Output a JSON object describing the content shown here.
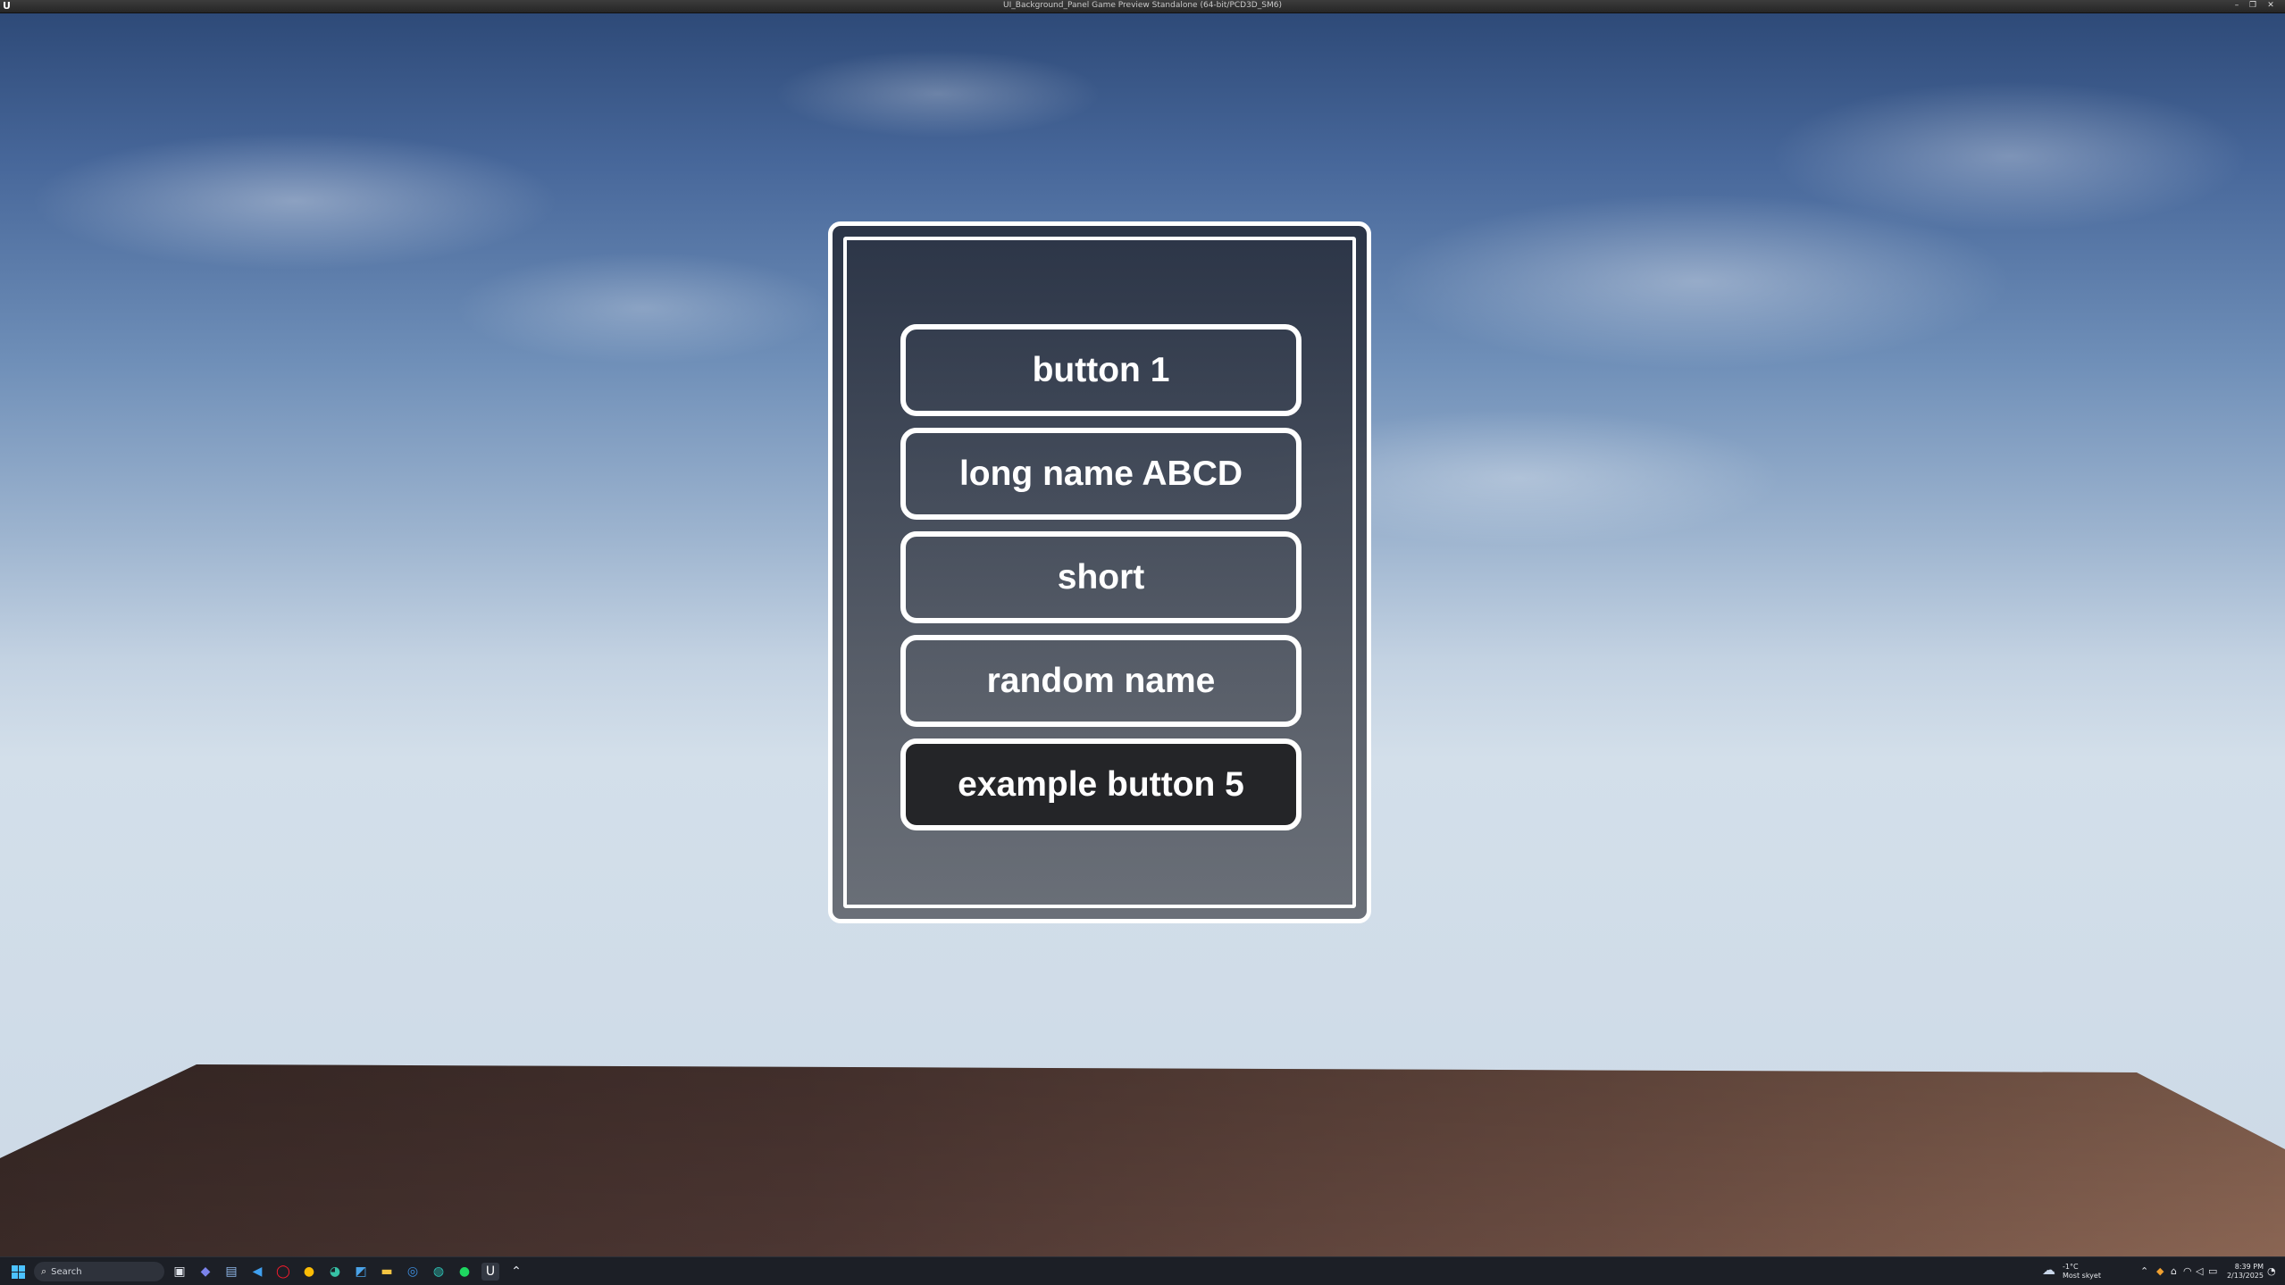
{
  "window": {
    "title": "UI_Background_Panel Game Preview Standalone (64-bit/PCD3D_SM6)",
    "minimize": "–",
    "restore": "❐",
    "close": "✕"
  },
  "menu": {
    "buttons": [
      {
        "label": "button 1",
        "hovered": false
      },
      {
        "label": "long name ABCD",
        "hovered": false
      },
      {
        "label": "short",
        "hovered": false
      },
      {
        "label": "random name",
        "hovered": false
      },
      {
        "label": "example button 5",
        "hovered": true
      }
    ]
  },
  "taskbar": {
    "search_placeholder": "Search",
    "apps": [
      "task-view-icon",
      "teams-icon",
      "file-manager-icon",
      "vscode-icon",
      "opera-icon",
      "chrome-icon",
      "edge-icon",
      "photos-icon",
      "folder-icon",
      "browser-icon",
      "edge-dev-icon",
      "spotify-icon",
      "unreal-engine-icon",
      "arrow-up-icon"
    ],
    "weather_temp": "-1°C",
    "weather_desc": "Most skyet",
    "time": "8:39 PM",
    "date": "2/13/2025"
  },
  "colors": {
    "panel_border": "#ffffff",
    "button_border": "#ffffff",
    "button_hover_bg": "#242528",
    "taskbar_bg": "#1c1f26"
  }
}
